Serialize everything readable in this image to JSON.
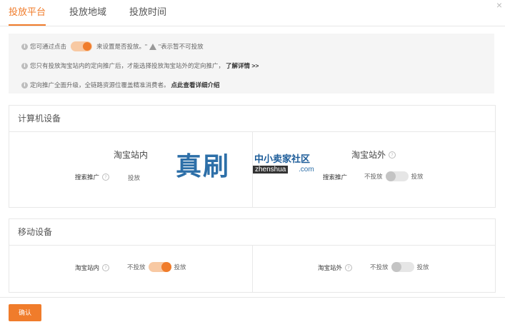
{
  "tabs": [
    {
      "label": "投放平台",
      "active": true
    },
    {
      "label": "投放地域",
      "active": false
    },
    {
      "label": "投放时间",
      "active": false
    }
  ],
  "close_glyph": "×",
  "notice": {
    "line1_before": "您可通过点击",
    "line1_after": "来设置是否投放。\"",
    "line1_end": "\"表示暂不可投放",
    "line2_text": "您只有投放淘宝站内的定向推广后，才能选择投放淘宝站外的定向推广，",
    "line2_link": "了解详情 >>",
    "line3_text": "定向推广全面升级，全链路资源位覆盖精准消费者。",
    "line3_link": "点此查看详细介绍"
  },
  "computer": {
    "title": "计算机设备",
    "left_head": "淘宝站内",
    "right_head": "淘宝站外",
    "left_label": "搜索推广",
    "left_value": "投放",
    "right_label": "搜索推广",
    "right_off": "不投放",
    "right_on": "投放",
    "right_toggle_on": false
  },
  "mobile": {
    "title": "移动设备",
    "left_label": "淘宝站内",
    "left_off": "不投放",
    "left_on": "投放",
    "left_toggle_on": true,
    "right_label": "淘宝站外",
    "right_off": "不投放",
    "right_on": "投放",
    "right_toggle_on": false
  },
  "confirm_label": "确认",
  "watermark": {
    "big": "真刷",
    "sub": "中小卖家社区",
    "url": "zhenshua",
    "com": ".com"
  },
  "colors": {
    "accent": "#f07c2b",
    "accent_light": "#f8c9a3"
  },
  "icons": [
    "info-icon",
    "warning-icon",
    "question-icon",
    "close-icon"
  ]
}
